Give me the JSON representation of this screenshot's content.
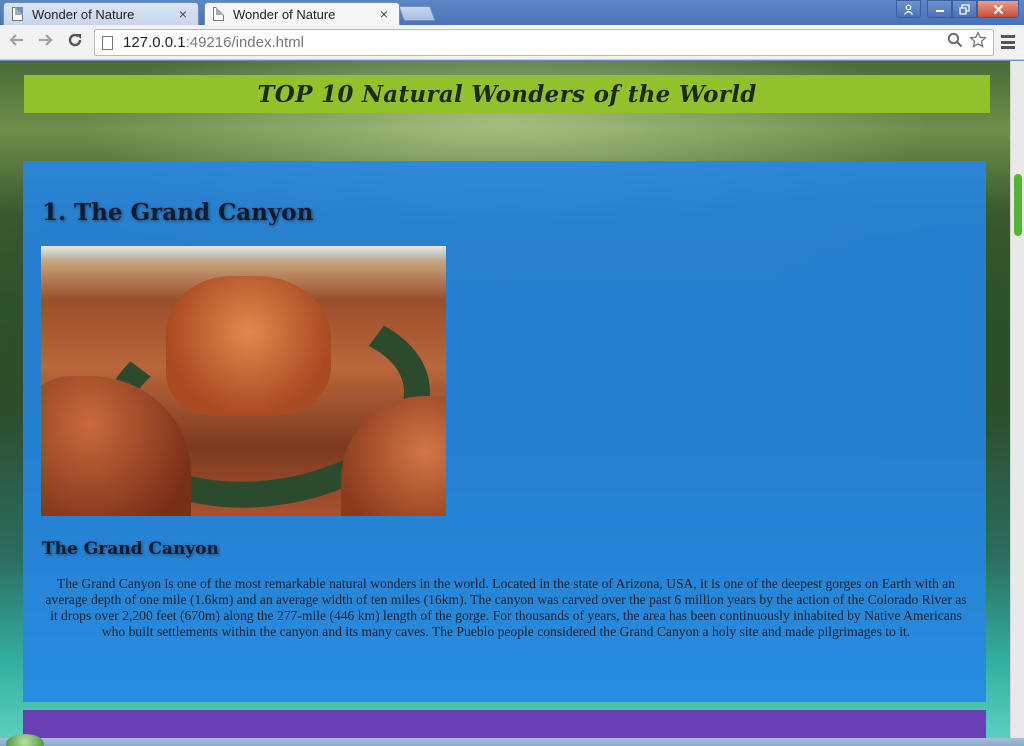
{
  "browser": {
    "tabs": [
      {
        "title": "Wonder of Nature",
        "active": false
      },
      {
        "title": "Wonder of Nature",
        "active": true
      }
    ],
    "close_glyph": "×",
    "url_host": "127.0.0.1",
    "url_port": ":49216",
    "url_path": "/index.html",
    "icons": {
      "back": "arrow-left-icon",
      "forward": "arrow-right-icon",
      "reload": "reload-icon",
      "zoom": "magnifier-icon",
      "bookmark": "star-icon",
      "menu": "hamburger-menu-icon"
    }
  },
  "page": {
    "site_title": "TOP 10 Natural Wonders of the World",
    "article": {
      "heading": "1. The Grand Canyon",
      "subheading": "The Grand Canyon",
      "body": "The Grand Canyon is one of the most remarkable natural wonders in the world. Located in the state of Arizona, USA, it is one of the deepest gorges on Earth with an average depth of one mile (1.6km) and an average width of ten miles (16km). The canyon was carved over the past 6 million years by the action of the Colorado River as it drops over 2,200 feet (670m) along the 277-mile (446 km) length of the gorge. For thousands of years, the area has been continuously inhabited by Native Americans who built settlements within the canyon and its many caves. The Pueblo people considered the Grand Canyon a holy site and made pilgrimages to it."
    },
    "colors": {
      "header_bar": "#93c12a",
      "article_panel": "#2686e6",
      "footer_bar": "#6a3fb6",
      "scroll_thumb": "#56b42f"
    }
  }
}
